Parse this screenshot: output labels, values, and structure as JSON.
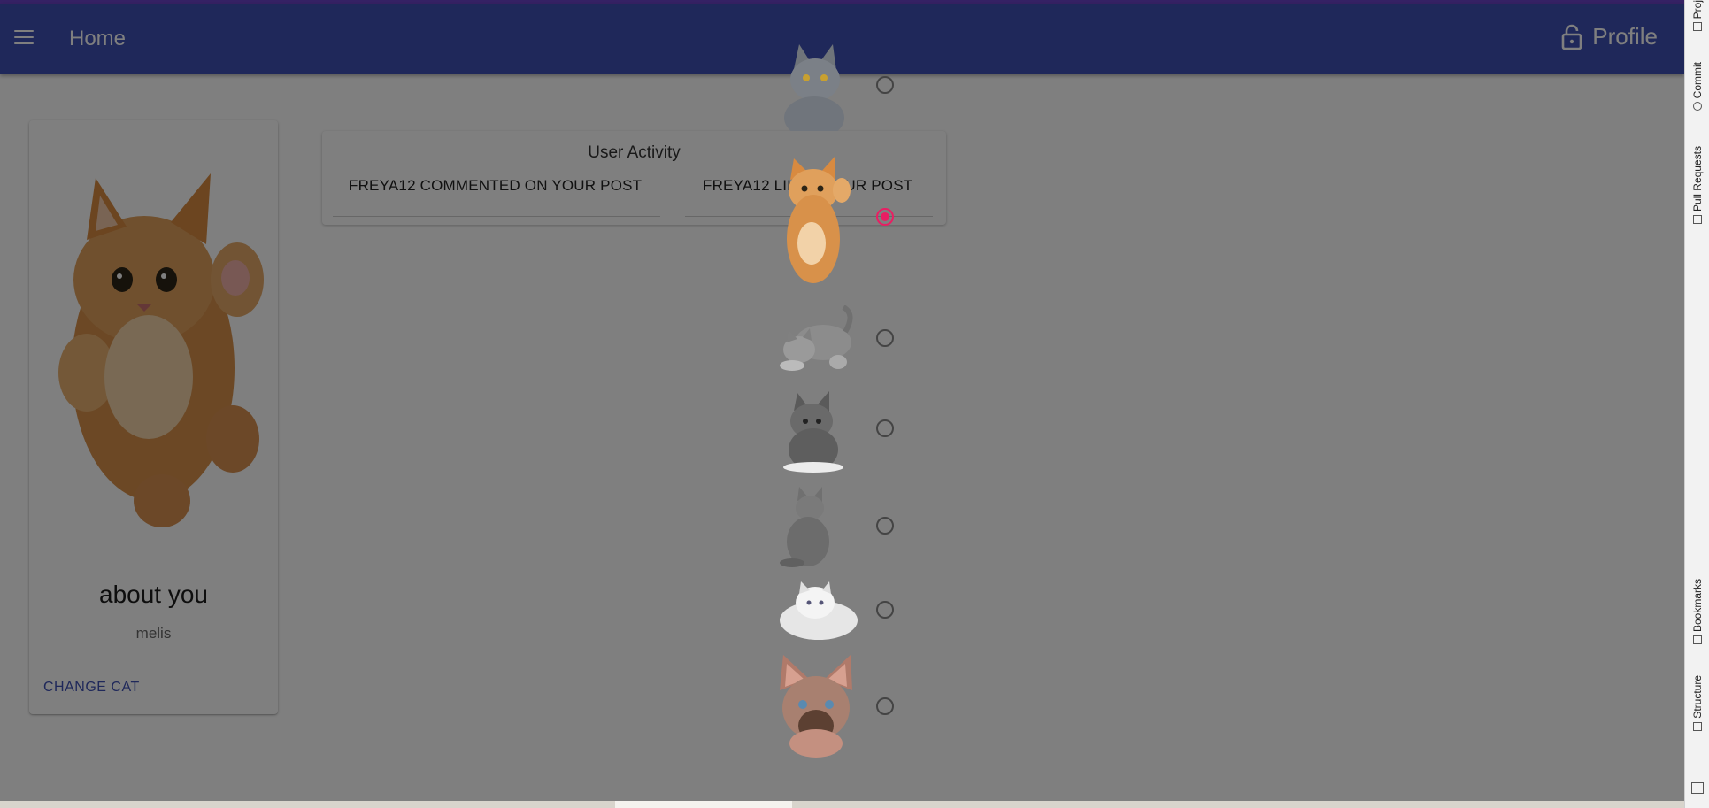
{
  "appbar": {
    "title": "Home",
    "profile_label": "Profile",
    "color": "#3f51b5"
  },
  "profile_card": {
    "heading": "about you",
    "username": "melis",
    "action_label": "CHANGE CAT"
  },
  "activity": {
    "title": "User Activity",
    "items": [
      "FREYA12 COMMENTED ON YOUR POST",
      "FREYA12 LIKED YOUR POST"
    ]
  },
  "cat_picker": {
    "accent": "#e91e63",
    "options": [
      {
        "icon": "gray-cat-icon",
        "checked": false
      },
      {
        "icon": "orange-kitten-icon",
        "checked": true
      },
      {
        "icon": "tabby-kitten-icon",
        "checked": false
      },
      {
        "icon": "small-tabby-kitten-icon",
        "checked": false
      },
      {
        "icon": "sitting-gray-cat-icon",
        "checked": false
      },
      {
        "icon": "white-persian-cat-icon",
        "checked": false
      },
      {
        "icon": "sphynx-cat-icon",
        "checked": false
      }
    ]
  },
  "ide_sidebar": {
    "tabs": [
      "Proj",
      "Commit",
      "Pull Requests",
      "Bookmarks",
      "Structure"
    ]
  }
}
